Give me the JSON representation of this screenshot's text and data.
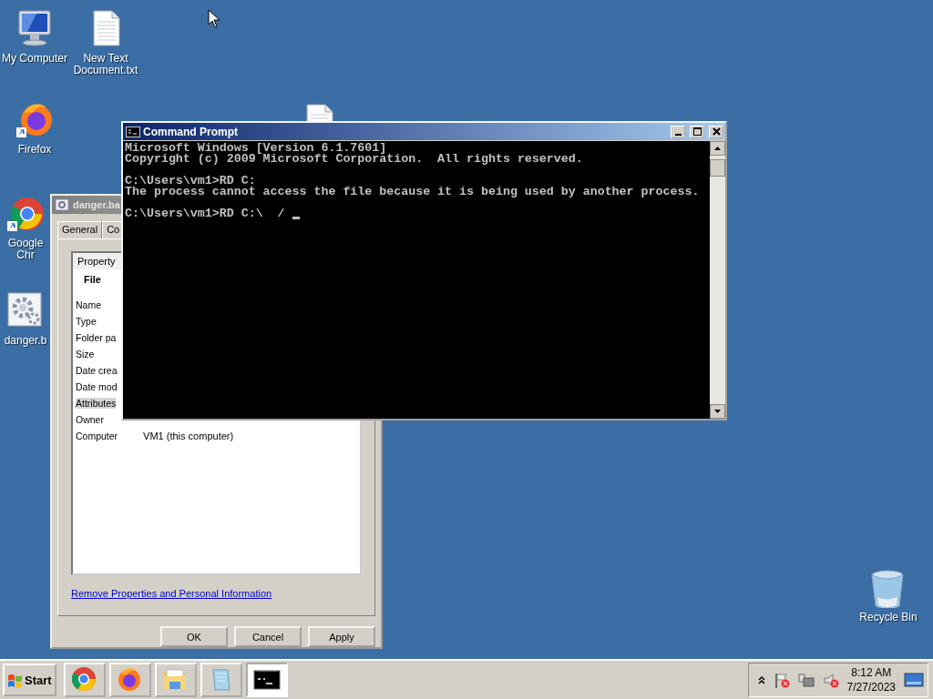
{
  "desktop_icons": [
    {
      "label": "My Computer"
    },
    {
      "label": "New Text Document.txt"
    },
    {
      "label": "Firefox"
    },
    {
      "label": "Google Chr"
    },
    {
      "label": "danger.b"
    },
    {
      "label": "Recycle Bin"
    }
  ],
  "properties_dialog": {
    "title": "danger.ba",
    "tabs": [
      {
        "label": "General",
        "selected": false
      },
      {
        "label": "Co",
        "selected": false
      }
    ],
    "column": "Property",
    "group": "File",
    "rows": [
      {
        "label": "Name",
        "selected": false
      },
      {
        "label": "Type",
        "selected": false
      },
      {
        "label": "Folder pa",
        "selected": false
      },
      {
        "label": "Size",
        "selected": false
      },
      {
        "label": "Date crea",
        "selected": false
      },
      {
        "label": "Date mod",
        "selected": false
      },
      {
        "label": "Attributes",
        "selected": true
      },
      {
        "label": "Owner",
        "selected": false
      },
      {
        "label": "Computer",
        "value": "VM1 (this computer)",
        "selected": false
      }
    ],
    "link": "Remove Properties and Personal Information",
    "buttons": [
      "OK",
      "Cancel",
      "Apply"
    ]
  },
  "command_prompt": {
    "title": "Command Prompt",
    "blocks": [
      [
        "Microsoft Windows [Version 6.1.7601]",
        "Copyright (c) 2009 Microsoft Corporation.  All rights reserved."
      ],
      [
        "C:\\Users\\vm1>RD C:",
        "The process cannot access the file because it is being used by another process."
      ],
      [
        "C:\\Users\\vm1>RD C:\\  /"
      ]
    ]
  },
  "taskbar": {
    "start": "Start",
    "apps": [
      {
        "selected": false
      },
      {
        "selected": false
      },
      {
        "selected": false
      },
      {
        "selected": false
      },
      {
        "selected": true
      }
    ],
    "time": "8:12 AM",
    "date": "7/27/2023"
  }
}
